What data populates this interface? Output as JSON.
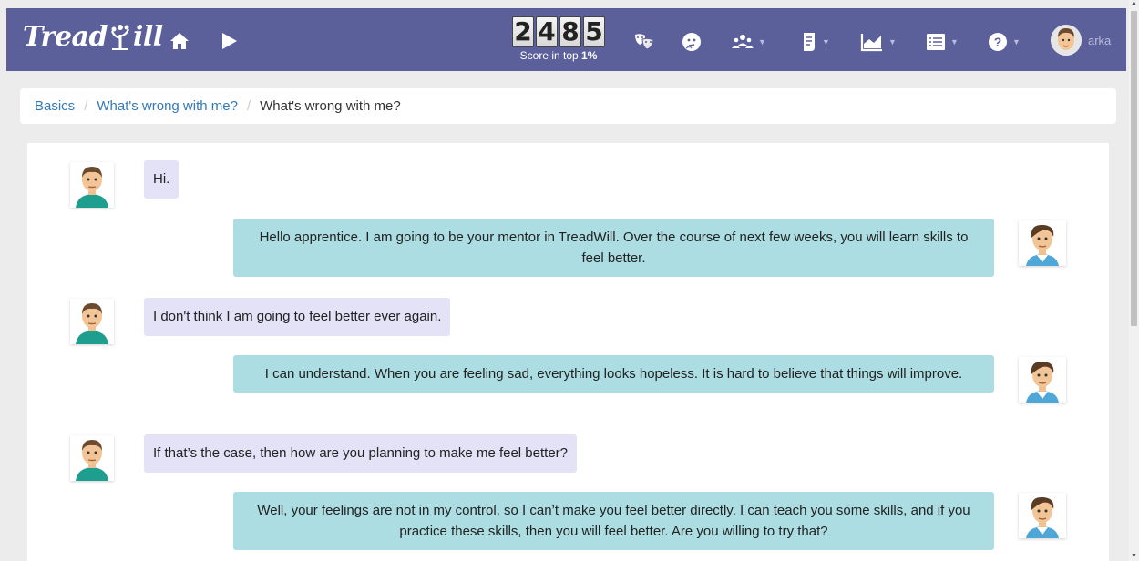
{
  "app": {
    "logo_part1": "Tread",
    "logo_part2": "ill",
    "username": "arka"
  },
  "nav": {
    "home_icon": "home-icon",
    "play_icon": "play-icon",
    "score_digits": [
      "2",
      "4",
      "8",
      "5"
    ],
    "score_caption_prefix": "Score in top ",
    "score_caption_value": "1%",
    "icons": [
      "masks-icon",
      "thinking-face-icon",
      "group-icon",
      "document-icon",
      "chart-icon",
      "list-icon",
      "help-icon"
    ]
  },
  "breadcrumb": {
    "items": [
      "Basics",
      "What's wrong with me?"
    ],
    "current": "What's wrong with me?"
  },
  "chat": {
    "messages": [
      {
        "sender": "user",
        "text": "Hi."
      },
      {
        "sender": "mentor",
        "text": "Hello apprentice. I am going to be your mentor in TreadWill. Over the course of next few weeks, you will learn skills to feel better."
      },
      {
        "sender": "user",
        "text": "I don't think I am going to feel better ever again."
      },
      {
        "sender": "mentor",
        "text": "I can understand. When you are feeling sad, everything looks hopeless. It is hard to believe that things will improve."
      },
      {
        "sender": "user",
        "text": "If that’s the case, then how are you planning to make me feel better?"
      },
      {
        "sender": "mentor",
        "text": "Well, your feelings are not in my control, so I can’t make you feel better directly. I can teach you some skills, and if you practice these skills, then you will feel better. Are you willing to try that?"
      }
    ]
  },
  "colors": {
    "navbar": "#5b5f9a",
    "user_bubble": "#e3e2f7",
    "mentor_bubble": "#abdde2",
    "link": "#337ab7"
  }
}
